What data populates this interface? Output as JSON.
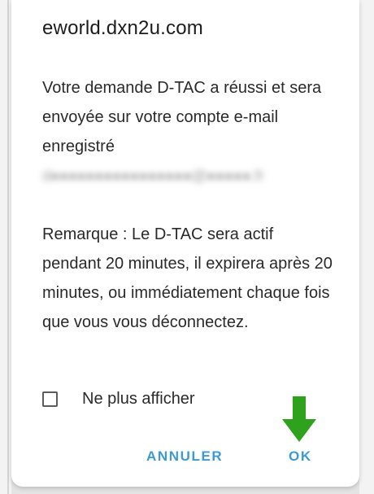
{
  "dialog": {
    "title": "eworld.dxn2u.com",
    "message_main": "Votre demande D-TAC a réussi et sera envoyée sur votre compte e-mail enregistré",
    "message_email_blurred": "d●●●●●●●●●●●●●●●●@●●●●●.fr",
    "message_remark": "Remarque : Le D-TAC sera actif pendant 20 minutes, il expirera après 20 minutes, ou immédiatement chaque fois que vous vous déconnectez.",
    "checkbox_label": "Ne plus afficher",
    "checkbox_checked": false,
    "cancel_label": "ANNULER",
    "ok_label": "OK"
  },
  "colors": {
    "button_text": "#3c9ad7",
    "arrow": "#2fa21d"
  }
}
